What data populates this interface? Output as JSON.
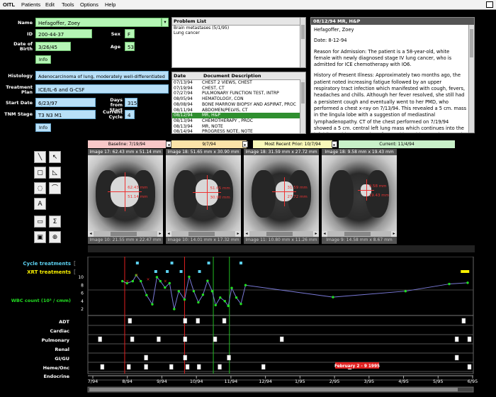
{
  "app": {
    "name": "OITL"
  },
  "menu": [
    "Patients",
    "Edit",
    "Tools",
    "Options",
    "Help"
  ],
  "patient": {
    "name_label": "Name",
    "name": "Hefagoffer, Zoey",
    "id_label": "ID",
    "id": "200-44-37",
    "sex_label": "Sex",
    "sex": "F",
    "dob_label": "Date of Birth",
    "dob": "3/26/45",
    "age_label": "Age",
    "age": "53",
    "info_label": "Info",
    "histology_label": "Histology",
    "histology": "Adenocarcinoma of lung, moderately well-differentiated",
    "plan_label": "Treatment Plan",
    "plan": "ICE/IL-6 and G-CSF",
    "start_label": "Start Date",
    "start": "6/23/97",
    "days_label": "Days from Start",
    "days": "315",
    "tnm_label": "TNM Stage",
    "tnm": "T3 N3 M1",
    "cycle_label": "Current Cycle",
    "cycle": "4"
  },
  "problem_list": {
    "header": "Problem List",
    "items": [
      "Brain metastases (5/1/95)",
      "Lung cancer"
    ]
  },
  "documents": {
    "date_header": "Date",
    "desc_header": "Document Description",
    "selected_index": 9,
    "rows": [
      {
        "date": "07/13/94",
        "desc": "CHEST 2 VIEWS, CHEST"
      },
      {
        "date": "07/19/94",
        "desc": "CHEST, CT"
      },
      {
        "date": "07/27/94",
        "desc": "PULMONARY FUNCTION TEST, INTRP"
      },
      {
        "date": "08/05/94",
        "desc": "HEMATOLOGY, CON"
      },
      {
        "date": "08/08/94",
        "desc": "BONE MARROW BIOPSY AND ASPIRAT, PROC"
      },
      {
        "date": "08/11/94",
        "desc": "ABDOMEN/PELVIS, CT"
      },
      {
        "date": "08/12/94",
        "desc": "MR, H&P"
      },
      {
        "date": "08/13/94",
        "desc": "CHEMOTHERAPY , PROC"
      },
      {
        "date": "08/13/94",
        "desc": "MR, NOTE"
      },
      {
        "date": "08/14/94",
        "desc": "PROGRESS NOTE, NOTE"
      }
    ]
  },
  "report": {
    "header": "08/12/94 MR, H&P",
    "name": "Hefagoffer, Zoey",
    "date_line": "Date: 8-12-94",
    "p1": "Reason for Admission: The patient is a 58-year-old, white female with newly diagnosed stage IV lung cancer, who is admitted for ICE chemotherapy with IO6.",
    "p2": "History of Present Illness: Approximately two months ago, the patient noted increasing fatigue followed by an upper respiratory tract infection which manifested with cough, fevers, headaches and chills. Although her fever resolved, she still had a persistent cough and eventually went to her PMD, who performed a chest x-ray on 7/13/94. This revealed a 5 cm. mass in the lingula lobe with a suggestion of mediastinal lymphadenopathy. CT of the chest performed on 7/19/94 showed a 5 cm. central left lung mass which continues into the left hilum with attenuation of central bronchi narrowing over the left pulmonary artery"
  },
  "image_strip": {
    "segments": [
      "Baseline: 7/19/94",
      "9/7/94",
      "Most Recent Prior: 10/7/94",
      "Current: 11/4/94"
    ],
    "segment_colors": [
      "#f8c8c8",
      "#fbe3a8",
      "#f8f8b8",
      "#c8f0c8"
    ],
    "images": [
      {
        "caption": "Image 17: 62.43 mm x 51.14 mm",
        "m1": "62.43 mm",
        "m2": "51.14 mm"
      },
      {
        "caption": "Image 18: 51.65 mm x 30.90 mm",
        "m1": "51.65 mm",
        "m2": "30.90 mm"
      },
      {
        "caption": "Image 18: 31.59 mm x 27.72 mm",
        "m1": "31.59 mm",
        "m2": "27.72 mm"
      },
      {
        "caption": "Image 18: 9.58 mm x 19.43 mm",
        "m1": "9.58 mm",
        "m2": "19.43 mm"
      }
    ],
    "second_row": [
      "Image 10: 21.55 mm x 22.47 mm",
      "Image 10: 14.01 mm x 17.32 mm",
      "Image 11: 10.80 mm x 11.26 mm",
      "Image 9: 14.58 mm x 8.67 mm"
    ]
  },
  "tools": [
    "line-tool-icon",
    "pointer-tool-icon",
    "rect-tool-icon",
    "polygon-tool-icon",
    "freehand-tool-icon",
    "lasso-tool-icon",
    "text-tool-icon",
    "ruler-tool-icon",
    "sum-tool-icon",
    "save-tool-icon",
    "zoom-tool-icon"
  ],
  "timeline": {
    "cycle_label": "Cycle treatments",
    "xrt_label": "XRT treatments",
    "wbc_label": "WBC count (10³ / cmm)",
    "y_ticks": [
      "10",
      "8",
      "6",
      "4",
      "2"
    ],
    "rows": [
      "ADT",
      "Cardiac",
      "Pulmonary",
      "Renal",
      "GI/GU",
      "Heme/Onc",
      "Endocrine"
    ],
    "x_labels": [
      "7/94",
      "8/94",
      "9/94",
      "10/94",
      "11/94",
      "12/94",
      "1/95",
      "2/95",
      "3/95",
      "4/95",
      "5/95",
      "6/95"
    ],
    "highlight_label": "February 2 - 9 1995",
    "colors": {
      "cycle": "#5bd0f0",
      "xrt": "#f8f000",
      "wbc": "#22dd22",
      "red_line": "#e02020",
      "green_line": "#22bb22"
    }
  },
  "chart_data": {
    "type": "line",
    "title": "",
    "ylabel": "WBC count (10³ / cmm)",
    "ylim": [
      0,
      12
    ],
    "series": [
      {
        "name": "WBC count (10³ / cmm)",
        "x": [
          "8/1/94",
          "8/5/94",
          "8/10/94",
          "8/13/94",
          "8/17/94",
          "8/22/94",
          "8/27/94",
          "9/1/94",
          "9/4/94",
          "9/8/94",
          "9/12/94",
          "9/16/94",
          "9/20/94",
          "9/25/94",
          "9/29/94",
          "10/3/94",
          "10/7/94",
          "10/11/94",
          "10/15/94",
          "10/19/94",
          "10/22/94",
          "10/26/94",
          "10/30/94",
          "11/3/94",
          "11/6/94",
          "11/10/94",
          "11/14/94",
          "11/18/94",
          "2/4/95",
          "4/7/95",
          "5/15/95",
          "6/1/95"
        ],
        "values": [
          9,
          8.5,
          9,
          10.5,
          9,
          5.5,
          3.2,
          10,
          9,
          7.4,
          8.5,
          2,
          6.5,
          4.4,
          10.1,
          6.5,
          3.7,
          5.6,
          9.1,
          6.5,
          3,
          4.9,
          4,
          2.8,
          7.3,
          4.9,
          3.3,
          8,
          5,
          6.5,
          8.3,
          8.6
        ]
      }
    ]
  }
}
